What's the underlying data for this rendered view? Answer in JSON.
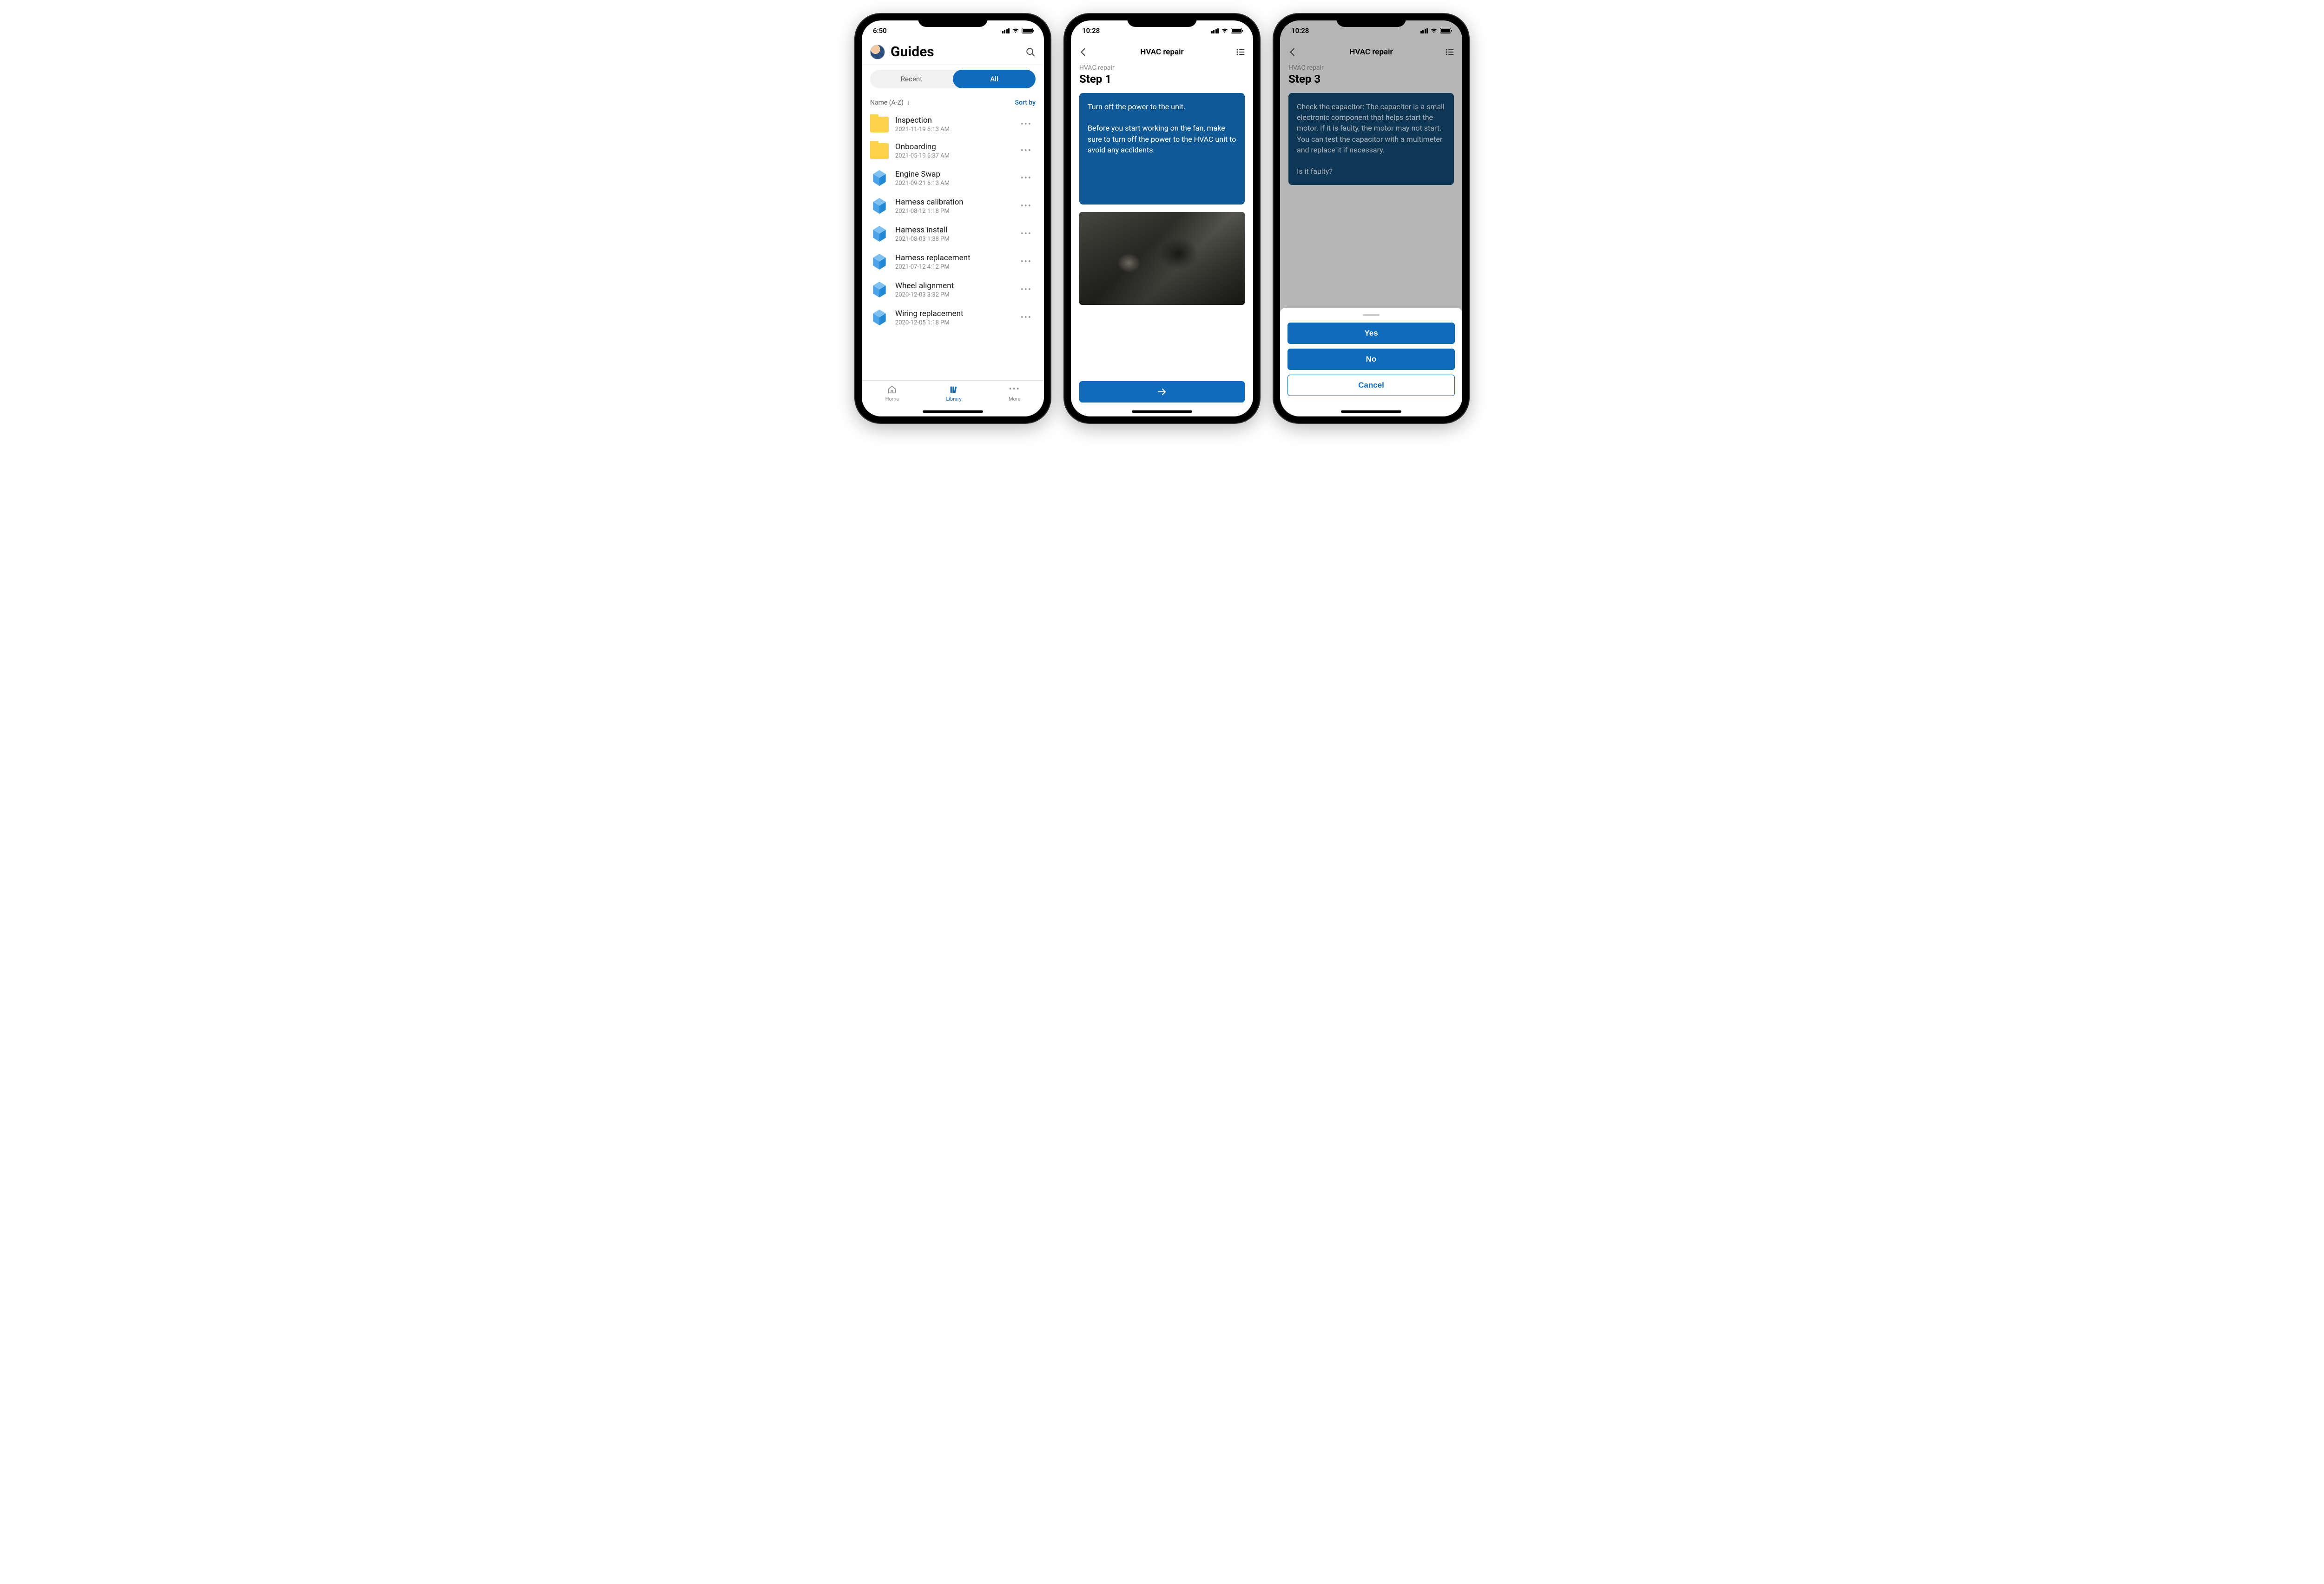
{
  "screen1": {
    "status_time": "6:50",
    "title": "Guides",
    "tabs": {
      "recent": "Recent",
      "all": "All"
    },
    "sort_label": "Name (A-Z)",
    "sort_by": "Sort by",
    "items": [
      {
        "type": "folder",
        "title": "Inspection",
        "subtitle": "2021-11-19 6:13 AM"
      },
      {
        "type": "folder",
        "title": "Onboarding",
        "subtitle": "2021-05-19 6:37 AM"
      },
      {
        "type": "guide",
        "title": "Engine Swap",
        "subtitle": "2021-09-21 6:13 AM"
      },
      {
        "type": "guide",
        "title": "Harness calibration",
        "subtitle": "2021-08-12 1:18 PM"
      },
      {
        "type": "guide",
        "title": "Harness install",
        "subtitle": "2021-08-03 1:38 PM"
      },
      {
        "type": "guide",
        "title": "Harness replacement",
        "subtitle": "2021-07-12 4:12 PM"
      },
      {
        "type": "guide",
        "title": "Wheel alignment",
        "subtitle": "2020-12-03 3:32 PM"
      },
      {
        "type": "guide",
        "title": "Wiring replacement",
        "subtitle": "2020-12-05 1:18 PM"
      }
    ],
    "nav": {
      "home": "Home",
      "library": "Library",
      "more": "More"
    }
  },
  "screen2": {
    "status_time": "10:28",
    "title": "HVAC repair",
    "crumb": "HVAC repair",
    "step_label": "Step 1",
    "instruction": "Turn off the power to the unit.\n\nBefore you start working on the fan, make sure to turn off the power to the HVAC unit to avoid any accidents."
  },
  "screen3": {
    "status_time": "10:28",
    "title": "HVAC repair",
    "crumb": "HVAC repair",
    "step_label": "Step 3",
    "instruction": "Check the capacitor: The capacitor is a small electronic component that helps start the motor. If it is faulty, the motor may not start. You can test the capacitor with a multimeter and replace it if necessary.\n\nIs it faulty?",
    "sheet": {
      "yes": "Yes",
      "no": "No",
      "cancel": "Cancel"
    }
  }
}
